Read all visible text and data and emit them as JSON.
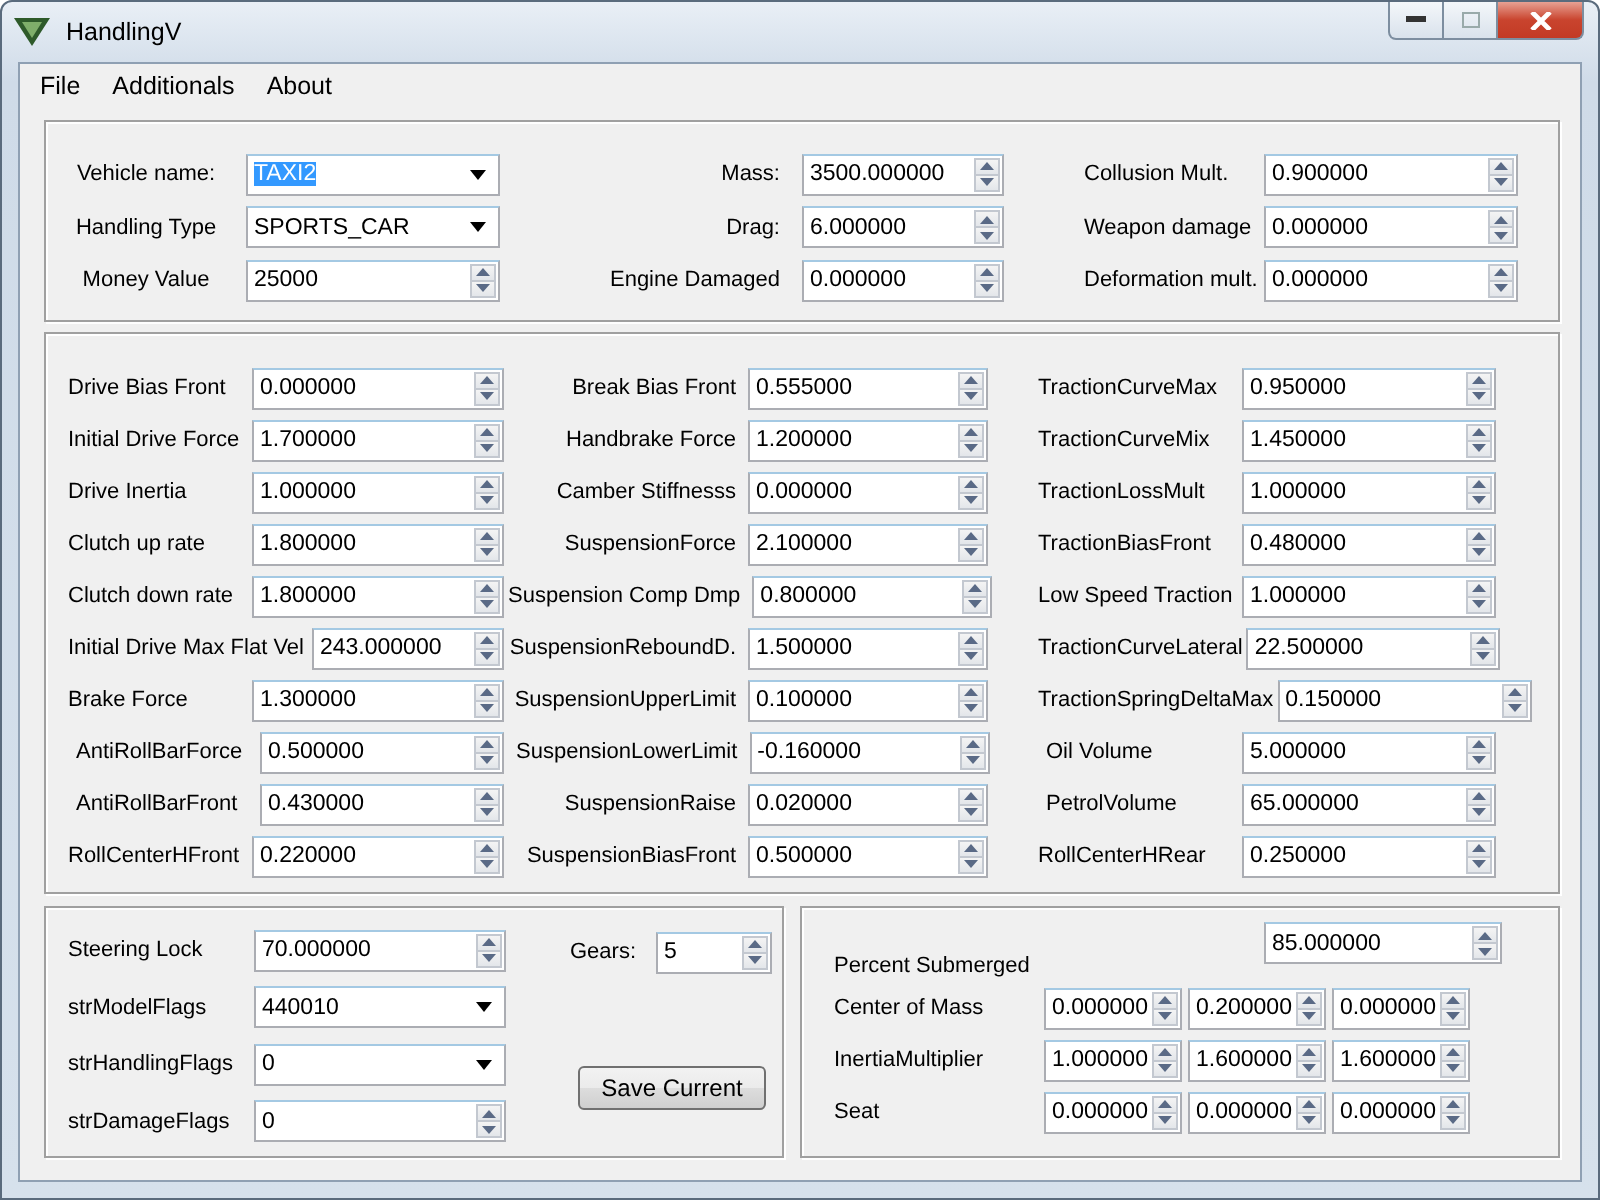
{
  "window": {
    "title": "HandlingV"
  },
  "menu": [
    "File",
    "Additionals",
    "About"
  ],
  "general": {
    "columns": [
      [
        {
          "kind": "combo",
          "label": "Vehicle name:",
          "value": "TAXI2",
          "highlighted": true
        },
        {
          "kind": "combo",
          "label": "Handling Type",
          "value": "SPORTS_CAR"
        },
        {
          "kind": "spin",
          "label": "Money Value",
          "value": "25000"
        }
      ],
      [
        {
          "kind": "spin",
          "label": "Mass:",
          "value": "3500.000000"
        },
        {
          "kind": "spin",
          "label": "Drag:",
          "value": "6.000000"
        },
        {
          "kind": "spin",
          "label": "Engine Damaged",
          "value": "0.000000"
        }
      ],
      [
        {
          "kind": "spin",
          "label": "Collusion Mult.",
          "value": "0.900000"
        },
        {
          "kind": "spin",
          "label": "Weapon damage",
          "value": "0.000000"
        },
        {
          "kind": "spin",
          "label": "Deformation mult.",
          "value": "0.000000"
        }
      ]
    ]
  },
  "parameters": {
    "columns": [
      [
        {
          "kind": "spin",
          "label": "Drive Bias Front",
          "value": "0.000000"
        },
        {
          "kind": "spin",
          "label": "Initial Drive Force",
          "value": "1.700000"
        },
        {
          "kind": "spin",
          "label": "Drive Inertia",
          "value": "1.000000"
        },
        {
          "kind": "spin",
          "label": "Clutch up rate",
          "value": "1.800000"
        },
        {
          "kind": "spin",
          "label": "Clutch down rate",
          "value": "1.800000"
        },
        {
          "kind": "spin",
          "label": "Initial Drive Max Flat Vel",
          "value": "243.000000"
        },
        {
          "kind": "spin",
          "label": "Brake Force",
          "value": "1.300000"
        },
        {
          "kind": "spin",
          "label": "AntiRollBarForce",
          "value": "0.500000"
        },
        {
          "kind": "spin",
          "label": "AntiRollBarFront",
          "value": "0.430000"
        },
        {
          "kind": "spin",
          "label": "RollCenterHFront",
          "value": "0.220000"
        }
      ],
      [
        {
          "kind": "spin",
          "label": "Break Bias Front",
          "value": "0.555000"
        },
        {
          "kind": "spin",
          "label": "Handbrake Force",
          "value": "1.200000"
        },
        {
          "kind": "spin",
          "label": "Camber Stiffnesss",
          "value": "0.000000"
        },
        {
          "kind": "spin",
          "label": "SuspensionForce",
          "value": "2.100000"
        },
        {
          "kind": "spin",
          "label": "Suspension Comp Dmp",
          "value": "0.800000"
        },
        {
          "kind": "spin",
          "label": "SuspensionReboundD.",
          "value": "1.500000"
        },
        {
          "kind": "spin",
          "label": "SuspensionUpperLimit",
          "value": "0.100000"
        },
        {
          "kind": "spin",
          "label": "SuspensionLowerLimit",
          "value": "-0.160000"
        },
        {
          "kind": "spin",
          "label": "SuspensionRaise",
          "value": "0.020000"
        },
        {
          "kind": "spin",
          "label": "SuspensionBiasFront",
          "value": "0.500000"
        }
      ],
      [
        {
          "kind": "spin",
          "label": "TractionCurveMax",
          "value": "0.950000"
        },
        {
          "kind": "spin",
          "label": "TractionCurveMix",
          "value": "1.450000"
        },
        {
          "kind": "spin",
          "label": "TractionLossMult",
          "value": "1.000000"
        },
        {
          "kind": "spin",
          "label": "TractionBiasFront",
          "value": "0.480000"
        },
        {
          "kind": "spin",
          "label": "Low Speed Traction",
          "value": "1.000000"
        },
        {
          "kind": "spin",
          "label": "TractionCurveLateral",
          "value": "22.500000"
        },
        {
          "kind": "spin",
          "label": "TractionSpringDeltaMax",
          "value": "0.150000"
        },
        {
          "kind": "spin",
          "label": "Oil Volume",
          "value": "5.000000"
        },
        {
          "kind": "spin",
          "label": "PetrolVolume",
          "value": "65.000000"
        },
        {
          "kind": "spin",
          "label": "RollCenterHRear",
          "value": "0.250000"
        }
      ]
    ]
  },
  "steering": {
    "fields": [
      {
        "kind": "spin",
        "label": "Steering Lock",
        "value": "70.000000"
      },
      {
        "kind": "combo",
        "label": "strModelFlags",
        "value": "440010"
      },
      {
        "kind": "combo",
        "label": "strHandlingFlags",
        "value": "0"
      },
      {
        "kind": "spin",
        "label": "strDamageFlags",
        "value": "0"
      }
    ],
    "gears": {
      "label": "Gears:",
      "value": "5"
    },
    "save_button": "Save Current"
  },
  "physics": {
    "percent_submerged": {
      "label": "Percent Submerged",
      "value": "85.000000"
    },
    "vectors": [
      {
        "label": "Center of Mass",
        "values": [
          "0.000000",
          "0.200000",
          "0.000000"
        ]
      },
      {
        "label": "InertiaMultiplier",
        "values": [
          "1.000000",
          "1.600000",
          "1.600000"
        ]
      },
      {
        "label": "Seat",
        "values": [
          "0.000000",
          "0.000000",
          "0.000000"
        ]
      }
    ]
  }
}
